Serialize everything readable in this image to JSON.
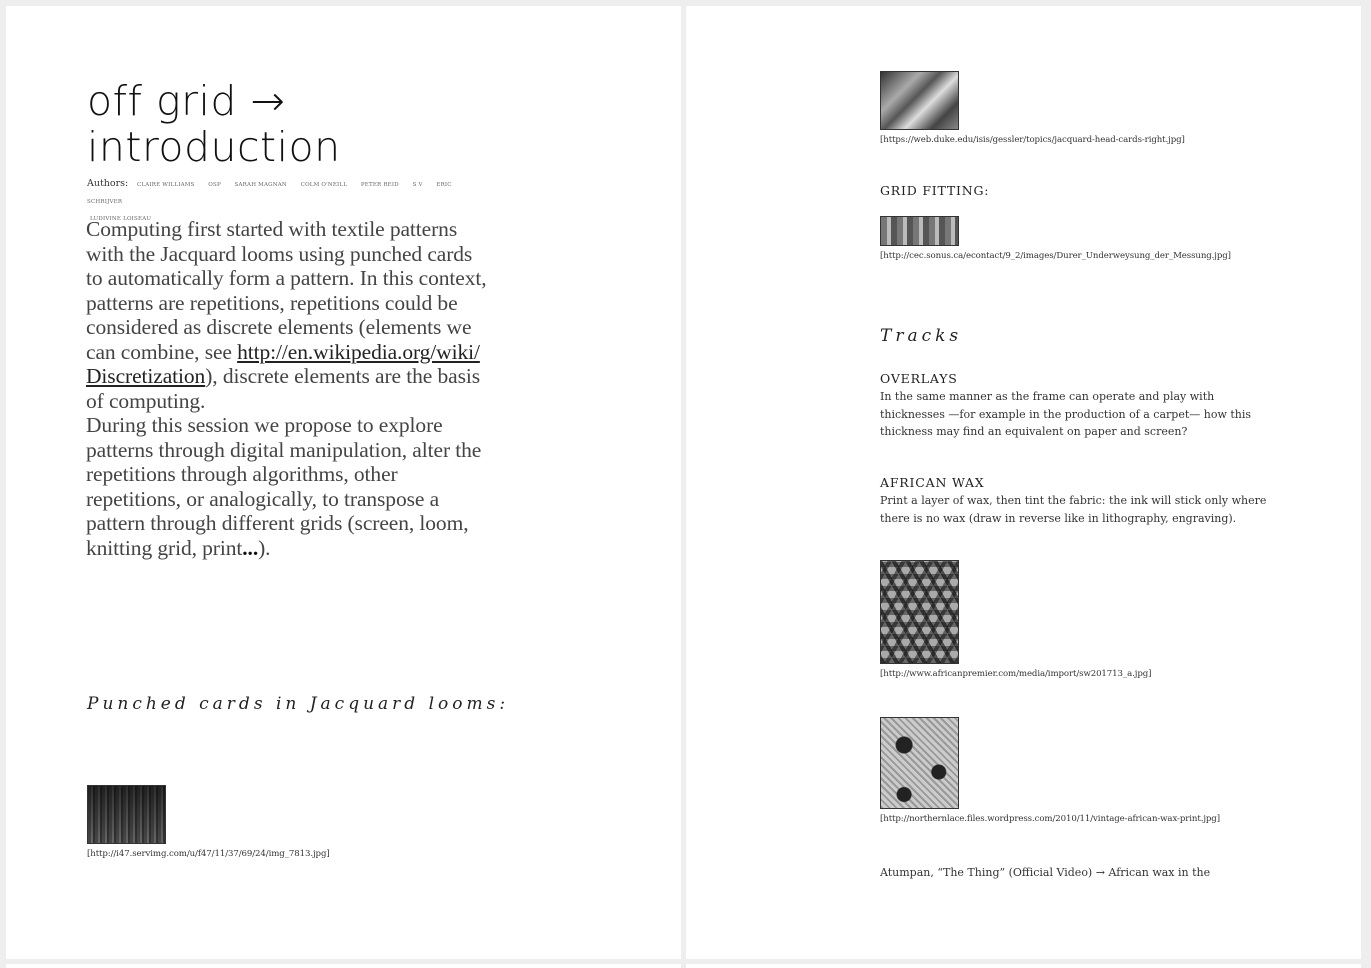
{
  "left_page": {
    "title_line1": "off grid →",
    "title_line2": "introduction",
    "authors_label": "Authors:",
    "authors": [
      "CLAIRE WILLIAMS",
      "OSP",
      "SARAH MAGNAN",
      "COLM O'NEILL",
      "PETER REID",
      "S V",
      "ERIC SCHRIJVER",
      "LUDIVINE LOISEAU"
    ],
    "intro_p1_text": "Computing first started with textile patterns with the Jacquard looms using punched cards to automatically form a pattern. In this context, patterns are repetitions, repetitions could be considered as discrete elements (elements we can combine, see ",
    "intro_p1_link": "http://en.wikipedia.org/wiki/Discretization",
    "intro_p1_after": "), discrete elements are the basis of computing.",
    "intro_p2_text": "During this session we propose to explore patterns through digital manipulation, alter the repetitions through algorithms, other repetitions, or analogically, to transpose a pattern through different grids (screen, loom, knitting grid, print",
    "intro_p2_dots": "...",
    "intro_p2_end": ").",
    "punched_heading": "Punched cards in Jacquard looms:",
    "image_caption": "[http://i47.servimg.com/u/f47/11/37/69/24/img_7813.jpg]"
  },
  "right_page": {
    "image1_caption": "[https://web.duke.edu/isis/gessler/topics/jacquard-head-cards-right.jpg]",
    "grid_fitting_heading": "GRID FITTING:",
    "image2_caption": "[http://cec.sonus.ca/econtact/9_2/images/Durer_Underweysung_der_Messung.jpg]",
    "tracks_heading": "Tracks",
    "overlays_heading": "OVERLAYS",
    "overlays_text": "In the same manner as the frame can operate and play with thicknesses —for example in the production of a carpet— how this thickness may find an equivalent on paper and screen?",
    "african_wax_heading": "AFRICAN WAX",
    "african_wax_text": "Print a layer of wax, then tint the fabric: the ink will stick only where there is no wax (draw in reverse like in lithography, engraving).",
    "image3_caption": "[http://www.africanpremier.com/media/import/sw201713_a.jpg]",
    "image4_caption": "[http://northernlace.files.wordpress.com/2010/11/vintage-african-wax-print.jpg]",
    "atumpan_text": "Atumpan, “The Thing” (Official Video) → African wax in the"
  }
}
